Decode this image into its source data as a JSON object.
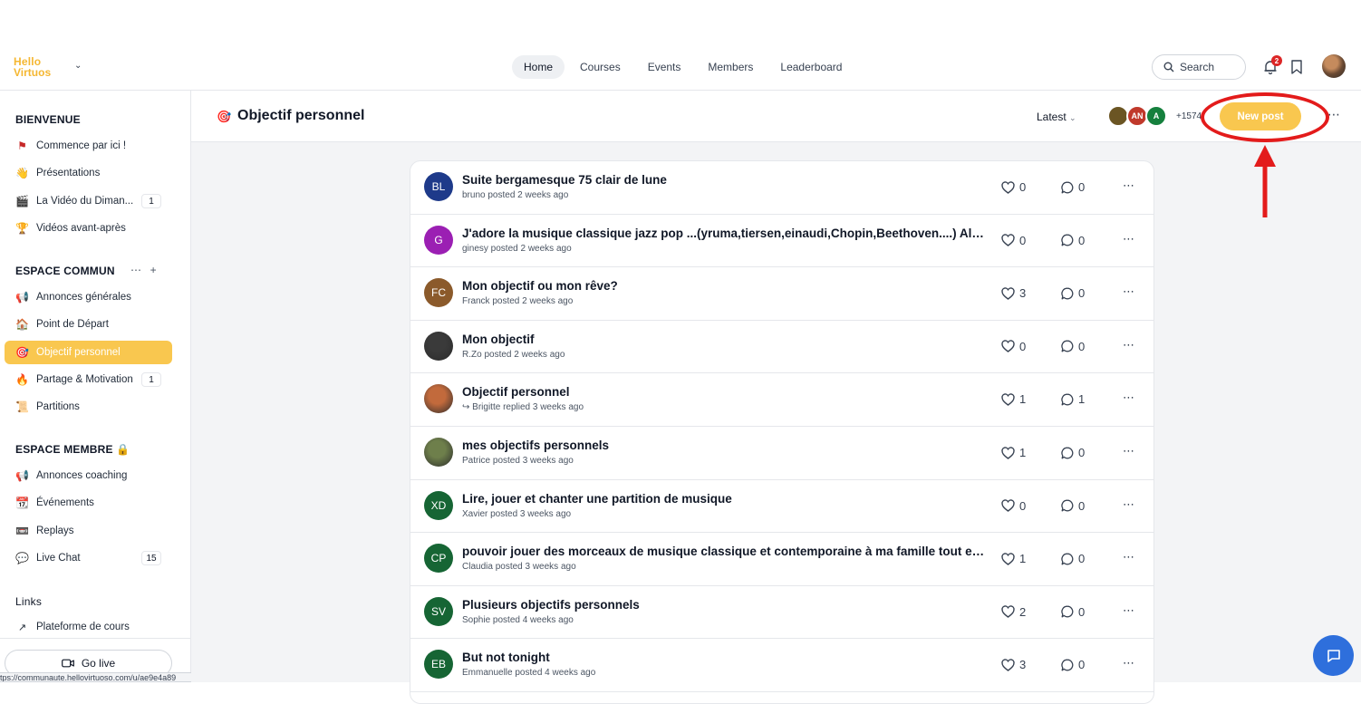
{
  "brand": {
    "logo_line1": "Hello",
    "logo_line2": "Virtuos"
  },
  "nav": {
    "tabs": [
      {
        "label": "Home",
        "active": true
      },
      {
        "label": "Courses"
      },
      {
        "label": "Events"
      },
      {
        "label": "Members"
      },
      {
        "label": "Leaderboard"
      }
    ],
    "search_label": "Search",
    "notification_count": "2"
  },
  "sidebar": {
    "sections": [
      {
        "title": "BIENVENUE",
        "items": [
          {
            "icon": "flag-icon",
            "emoji": "🚩",
            "label": "Commence par ici !"
          },
          {
            "icon": "waving-hand-icon",
            "emoji": "👋",
            "label": "Présentations"
          },
          {
            "icon": "clapperboard-icon",
            "emoji": "🎬",
            "label": "La Vidéo du Diman...",
            "count": "1"
          },
          {
            "icon": "trophy-icon",
            "emoji": "🏆",
            "label": "Vidéos avant-après"
          }
        ]
      },
      {
        "title": "ESPACE COMMUN",
        "items": [
          {
            "icon": "megaphone-icon",
            "emoji": "📢",
            "label": "Annonces générales"
          },
          {
            "icon": "house-icon",
            "emoji": "🏠",
            "label": "Point de Départ"
          },
          {
            "icon": "target-icon",
            "emoji": "🎯",
            "label": "Objectif personnel",
            "active": true
          },
          {
            "icon": "fire-icon",
            "emoji": "🔥",
            "label": "Partage & Motivation",
            "count": "1"
          },
          {
            "icon": "sheet-music-icon",
            "emoji": "📜",
            "label": "Partitions"
          }
        ]
      },
      {
        "title": "ESPACE MEMBRE 🔒",
        "items": [
          {
            "icon": "megaphone-icon",
            "emoji": "📢",
            "label": "Annonces coaching"
          },
          {
            "icon": "calendar-icon",
            "emoji": "📆",
            "label": "Événements"
          },
          {
            "icon": "film-icon",
            "emoji": "📼",
            "label": "Replays"
          },
          {
            "icon": "speech-bubble-icon",
            "emoji": "💬",
            "label": "Live Chat",
            "count": "15"
          }
        ]
      },
      {
        "title": "Links",
        "items": [
          {
            "icon": "external-link-icon",
            "emoji": "↗",
            "label": "Plateforme de cours"
          }
        ]
      }
    ],
    "go_live_label": "Go live",
    "status_url": "tps://communaute.hellovirtuoso.com/u/ae9e4a89"
  },
  "header": {
    "space_icon": "🎯",
    "space_title": "Objectif personnel",
    "sort_label": "Latest",
    "member_avatars": [
      {
        "initials": "",
        "color": "#6b5523"
      },
      {
        "initials": "AN",
        "color": "#c0392b"
      },
      {
        "initials": "A",
        "color": "#15803d"
      }
    ],
    "member_count": "+1574",
    "new_post_label": "New post"
  },
  "posts": [
    {
      "initials": "BL",
      "color": "#1e3a8a",
      "title": "Suite bergamesque 75 clair de lune",
      "meta": "bruno posted 2 weeks ago",
      "likes": "0",
      "comments": "0"
    },
    {
      "initials": "G",
      "color": "#9b1fb3",
      "title": "J'adore la musique classique jazz pop ...(yruma,tiersen,einaudi,Chopin,Beethoven....) Aller pl...",
      "meta": "ginesy posted 2 weeks ago",
      "likes": "0",
      "comments": "0"
    },
    {
      "initials": "FC",
      "color": "#8b5a2b",
      "title": "Mon objectif ou mon rêve?",
      "meta": "Franck posted 2 weeks ago",
      "likes": "3",
      "comments": "0"
    },
    {
      "initials": "",
      "color": "#3a3a3a",
      "photo": true,
      "title": "Mon objectif",
      "meta": "R.Zo posted 2 weeks ago",
      "likes": "0",
      "comments": "0"
    },
    {
      "initials": "",
      "color": "#c26a3c",
      "photo": true,
      "title": "Objectif personnel",
      "meta": "Brigitte replied 3 weeks ago",
      "replied": true,
      "likes": "1",
      "comments": "1"
    },
    {
      "initials": "",
      "color": "#6e7f4b",
      "photo": true,
      "title": "mes objectifs personnels",
      "meta": "Patrice posted 3 weeks ago",
      "likes": "1",
      "comments": "0"
    },
    {
      "initials": "XD",
      "color": "#166534",
      "title": "Lire, jouer et chanter une partition de musique",
      "meta": "Xavier posted 3 weeks ago",
      "likes": "0",
      "comments": "0"
    },
    {
      "initials": "CP",
      "color": "#166534",
      "title": "pouvoir jouer des morceaux  de musique classique et contemporaine à ma famille tout en...",
      "meta": "Claudia posted 3 weeks ago",
      "likes": "1",
      "comments": "0"
    },
    {
      "initials": "SV",
      "color": "#166534",
      "title": "Plusieurs objectifs personnels",
      "meta": "Sophie posted 4 weeks ago",
      "likes": "2",
      "comments": "0"
    },
    {
      "initials": "EB",
      "color": "#166534",
      "title": "But not tonight",
      "meta": "Emmanuelle posted 4 weeks ago",
      "likes": "3",
      "comments": "0"
    }
  ],
  "colors": {
    "accent": "#f9c74f",
    "annotation": "#e31b1b",
    "chat_fab": "#2e6fdc"
  }
}
